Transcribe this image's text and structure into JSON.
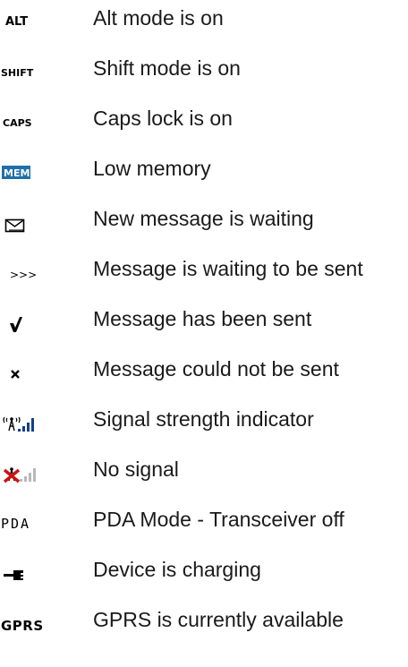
{
  "legend": {
    "items": [
      {
        "icon": "alt-mode-icon",
        "icon_text": "ALT",
        "label": "Alt mode is on"
      },
      {
        "icon": "shift-mode-icon",
        "icon_text": "SHIFT",
        "label": "Shift mode is on"
      },
      {
        "icon": "caps-lock-icon",
        "icon_text": "CAPS",
        "label": "Caps lock is on"
      },
      {
        "icon": "low-memory-icon",
        "icon_text": "MEM",
        "label": "Low memory"
      },
      {
        "icon": "envelope-icon",
        "label": "New message is waiting"
      },
      {
        "icon": "outbox-arrows-icon",
        "icon_text": ">>>",
        "label": "Message is waiting to be sent"
      },
      {
        "icon": "checkmark-icon",
        "label": "Message has been sent"
      },
      {
        "icon": "x-mark-icon",
        "label": "Message could not be sent"
      },
      {
        "icon": "signal-strength-icon",
        "label": "Signal strength indicator"
      },
      {
        "icon": "no-signal-icon",
        "label": "No signal"
      },
      {
        "icon": "pda-mode-icon",
        "icon_text": "PDA",
        "label": "PDA Mode - Transceiver off"
      },
      {
        "icon": "charging-plug-icon",
        "label": "Device is charging"
      },
      {
        "icon": "gprs-icon",
        "icon_text": "GPRS",
        "label": "GPRS is currently available"
      }
    ]
  },
  "colors": {
    "text": "#1a1a1a",
    "icon_black": "#000000",
    "mem_badge": "#1f6fa8",
    "signal_blue": "#123e8a",
    "no_signal_red": "#d01010",
    "signal_gray": "#b8b8b8"
  }
}
